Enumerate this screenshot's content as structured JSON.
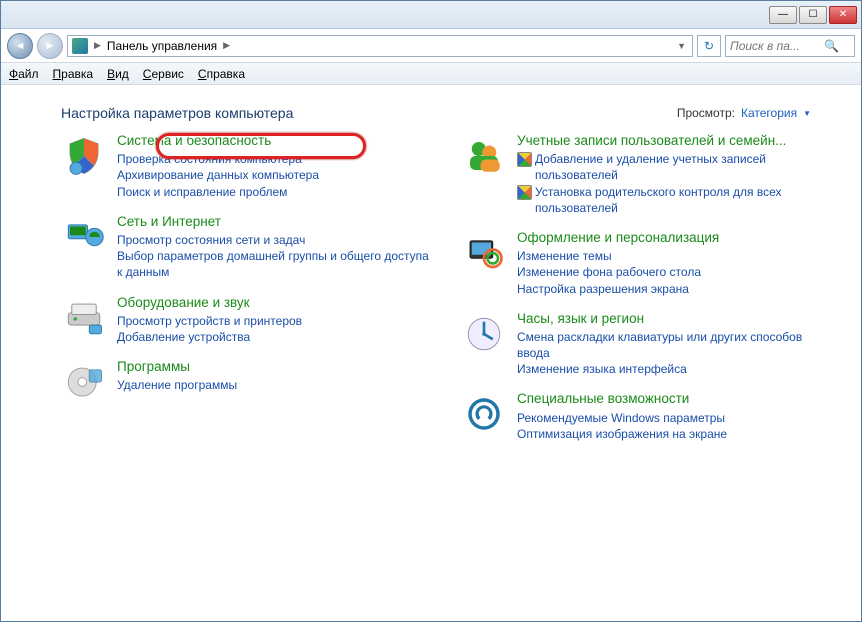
{
  "titlebar": {
    "min": "—",
    "max": "☐",
    "close": "✕"
  },
  "nav": {
    "breadcrumb_root": "Панель управления",
    "search_placeholder": "Поиск в па...",
    "search_icon": "🔍"
  },
  "menu": {
    "file": "Файл",
    "edit": "Правка",
    "view": "Вид",
    "tools": "Сервис",
    "help": "Справка"
  },
  "header": {
    "title": "Настройка параметров компьютера",
    "view_label": "Просмотр:",
    "view_value": "Категория"
  },
  "left": [
    {
      "title": "Система и безопасность",
      "links": [
        {
          "t": "Проверка состояния компьютера"
        },
        {
          "t": "Архивирование данных компьютера"
        },
        {
          "t": "Поиск и исправление проблем"
        }
      ]
    },
    {
      "title": "Сеть и Интернет",
      "links": [
        {
          "t": "Просмотр состояния сети и задач"
        },
        {
          "t": "Выбор параметров домашней группы и общего доступа к данным"
        }
      ]
    },
    {
      "title": "Оборудование и звук",
      "links": [
        {
          "t": "Просмотр устройств и принтеров"
        },
        {
          "t": "Добавление устройства"
        }
      ]
    },
    {
      "title": "Программы",
      "links": [
        {
          "t": "Удаление программы"
        }
      ]
    }
  ],
  "right": [
    {
      "title": "Учетные записи пользователей и семейн...",
      "links": [
        {
          "t": "Добавление и удаление учетных записей пользователей",
          "shield": true
        },
        {
          "t": "Установка родительского контроля для всех пользователей",
          "shield": true
        }
      ]
    },
    {
      "title": "Оформление и персонализация",
      "links": [
        {
          "t": "Изменение темы"
        },
        {
          "t": "Изменение фона рабочего стола"
        },
        {
          "t": "Настройка разрешения экрана"
        }
      ]
    },
    {
      "title": "Часы, язык и регион",
      "links": [
        {
          "t": "Смена раскладки клавиатуры или других способов ввода"
        },
        {
          "t": "Изменение языка интерфейса"
        }
      ]
    },
    {
      "title": "Специальные возможности",
      "links": [
        {
          "t": "Рекомендуемые Windows параметры"
        },
        {
          "t": "Оптимизация изображения на экране"
        }
      ]
    }
  ]
}
